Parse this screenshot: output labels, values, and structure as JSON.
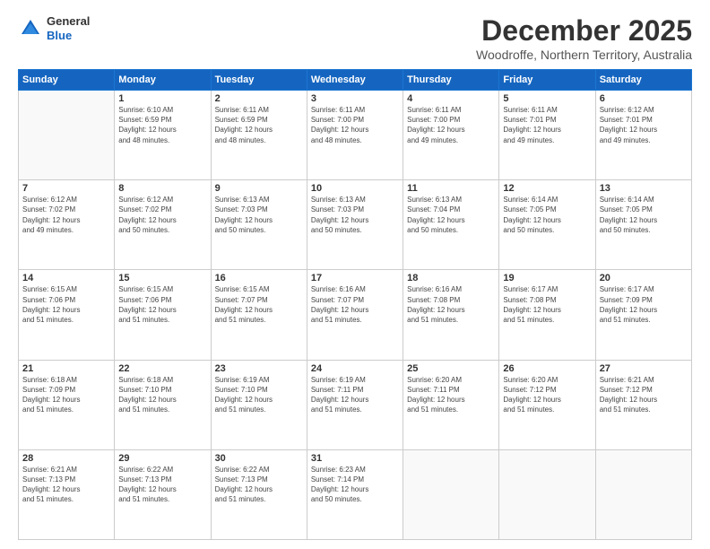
{
  "header": {
    "logo_general": "General",
    "logo_blue": "Blue",
    "title": "December 2025",
    "subtitle": "Woodroffe, Northern Territory, Australia"
  },
  "days_of_week": [
    "Sunday",
    "Monday",
    "Tuesday",
    "Wednesday",
    "Thursday",
    "Friday",
    "Saturday"
  ],
  "weeks": [
    [
      {
        "num": "",
        "info": ""
      },
      {
        "num": "1",
        "info": "Sunrise: 6:10 AM\nSunset: 6:59 PM\nDaylight: 12 hours\nand 48 minutes."
      },
      {
        "num": "2",
        "info": "Sunrise: 6:11 AM\nSunset: 6:59 PM\nDaylight: 12 hours\nand 48 minutes."
      },
      {
        "num": "3",
        "info": "Sunrise: 6:11 AM\nSunset: 7:00 PM\nDaylight: 12 hours\nand 48 minutes."
      },
      {
        "num": "4",
        "info": "Sunrise: 6:11 AM\nSunset: 7:00 PM\nDaylight: 12 hours\nand 49 minutes."
      },
      {
        "num": "5",
        "info": "Sunrise: 6:11 AM\nSunset: 7:01 PM\nDaylight: 12 hours\nand 49 minutes."
      },
      {
        "num": "6",
        "info": "Sunrise: 6:12 AM\nSunset: 7:01 PM\nDaylight: 12 hours\nand 49 minutes."
      }
    ],
    [
      {
        "num": "7",
        "info": "Sunrise: 6:12 AM\nSunset: 7:02 PM\nDaylight: 12 hours\nand 49 minutes."
      },
      {
        "num": "8",
        "info": "Sunrise: 6:12 AM\nSunset: 7:02 PM\nDaylight: 12 hours\nand 50 minutes."
      },
      {
        "num": "9",
        "info": "Sunrise: 6:13 AM\nSunset: 7:03 PM\nDaylight: 12 hours\nand 50 minutes."
      },
      {
        "num": "10",
        "info": "Sunrise: 6:13 AM\nSunset: 7:03 PM\nDaylight: 12 hours\nand 50 minutes."
      },
      {
        "num": "11",
        "info": "Sunrise: 6:13 AM\nSunset: 7:04 PM\nDaylight: 12 hours\nand 50 minutes."
      },
      {
        "num": "12",
        "info": "Sunrise: 6:14 AM\nSunset: 7:05 PM\nDaylight: 12 hours\nand 50 minutes."
      },
      {
        "num": "13",
        "info": "Sunrise: 6:14 AM\nSunset: 7:05 PM\nDaylight: 12 hours\nand 50 minutes."
      }
    ],
    [
      {
        "num": "14",
        "info": "Sunrise: 6:15 AM\nSunset: 7:06 PM\nDaylight: 12 hours\nand 51 minutes."
      },
      {
        "num": "15",
        "info": "Sunrise: 6:15 AM\nSunset: 7:06 PM\nDaylight: 12 hours\nand 51 minutes."
      },
      {
        "num": "16",
        "info": "Sunrise: 6:15 AM\nSunset: 7:07 PM\nDaylight: 12 hours\nand 51 minutes."
      },
      {
        "num": "17",
        "info": "Sunrise: 6:16 AM\nSunset: 7:07 PM\nDaylight: 12 hours\nand 51 minutes."
      },
      {
        "num": "18",
        "info": "Sunrise: 6:16 AM\nSunset: 7:08 PM\nDaylight: 12 hours\nand 51 minutes."
      },
      {
        "num": "19",
        "info": "Sunrise: 6:17 AM\nSunset: 7:08 PM\nDaylight: 12 hours\nand 51 minutes."
      },
      {
        "num": "20",
        "info": "Sunrise: 6:17 AM\nSunset: 7:09 PM\nDaylight: 12 hours\nand 51 minutes."
      }
    ],
    [
      {
        "num": "21",
        "info": "Sunrise: 6:18 AM\nSunset: 7:09 PM\nDaylight: 12 hours\nand 51 minutes."
      },
      {
        "num": "22",
        "info": "Sunrise: 6:18 AM\nSunset: 7:10 PM\nDaylight: 12 hours\nand 51 minutes."
      },
      {
        "num": "23",
        "info": "Sunrise: 6:19 AM\nSunset: 7:10 PM\nDaylight: 12 hours\nand 51 minutes."
      },
      {
        "num": "24",
        "info": "Sunrise: 6:19 AM\nSunset: 7:11 PM\nDaylight: 12 hours\nand 51 minutes."
      },
      {
        "num": "25",
        "info": "Sunrise: 6:20 AM\nSunset: 7:11 PM\nDaylight: 12 hours\nand 51 minutes."
      },
      {
        "num": "26",
        "info": "Sunrise: 6:20 AM\nSunset: 7:12 PM\nDaylight: 12 hours\nand 51 minutes."
      },
      {
        "num": "27",
        "info": "Sunrise: 6:21 AM\nSunset: 7:12 PM\nDaylight: 12 hours\nand 51 minutes."
      }
    ],
    [
      {
        "num": "28",
        "info": "Sunrise: 6:21 AM\nSunset: 7:13 PM\nDaylight: 12 hours\nand 51 minutes."
      },
      {
        "num": "29",
        "info": "Sunrise: 6:22 AM\nSunset: 7:13 PM\nDaylight: 12 hours\nand 51 minutes."
      },
      {
        "num": "30",
        "info": "Sunrise: 6:22 AM\nSunset: 7:13 PM\nDaylight: 12 hours\nand 51 minutes."
      },
      {
        "num": "31",
        "info": "Sunrise: 6:23 AM\nSunset: 7:14 PM\nDaylight: 12 hours\nand 50 minutes."
      },
      {
        "num": "",
        "info": ""
      },
      {
        "num": "",
        "info": ""
      },
      {
        "num": "",
        "info": ""
      }
    ]
  ]
}
